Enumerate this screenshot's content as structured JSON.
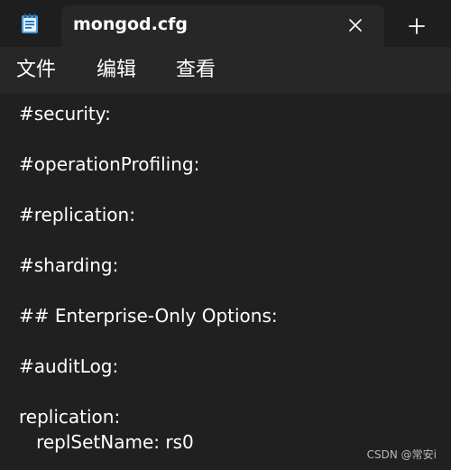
{
  "window": {
    "tab_title": "mongod.cfg",
    "icons": {
      "app": "notepad-icon",
      "close": "close-icon",
      "new_tab": "plus-icon"
    }
  },
  "menubar": {
    "items": [
      {
        "label": "文件"
      },
      {
        "label": "编辑"
      },
      {
        "label": "查看"
      }
    ]
  },
  "editor": {
    "lines": [
      "#security:",
      "",
      "#operationProfiling:",
      "",
      "#replication:",
      "",
      "#sharding:",
      "",
      "## Enterprise-Only Options:",
      "",
      "#auditLog:",
      "",
      "replication:",
      "   replSetName: rs0"
    ]
  },
  "watermark": "CSDN @常安i",
  "colors": {
    "tabbar_bg": "#1e1e1e",
    "tab_bg": "#272727",
    "editor_bg": "#202020",
    "text": "#ffffff",
    "icon_accent": "#4a9bd9"
  }
}
